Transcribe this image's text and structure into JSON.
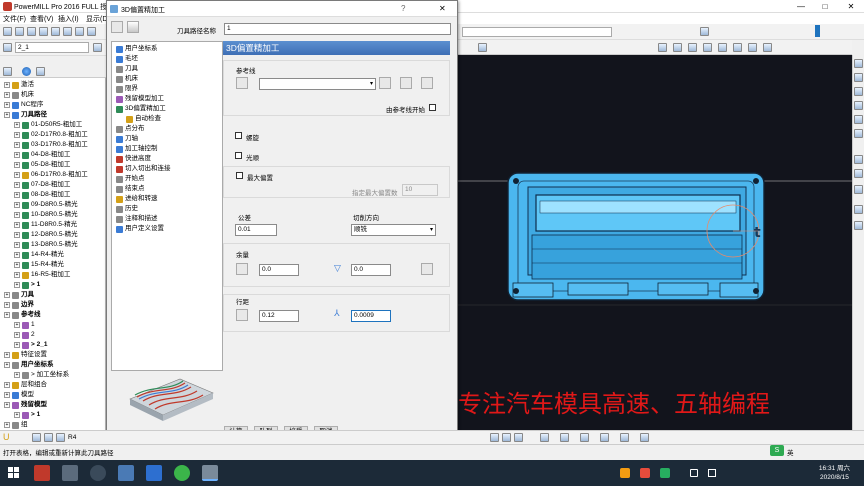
{
  "app": {
    "title": "PowerMILL Pro 2016 FULL 授",
    "window_buttons": [
      "—",
      "□",
      "✕"
    ]
  },
  "menu": {
    "items": [
      "文件(F)",
      "查看(V)",
      "插入(I)",
      "显示(D"
    ]
  },
  "toolbar": {
    "wcs_value": "2_1"
  },
  "explorer": {
    "items": [
      {
        "label": "激活",
        "indent": 0,
        "icon_color": "#d4a017"
      },
      {
        "label": "机床",
        "indent": 0,
        "icon_color": "#888888"
      },
      {
        "label": "NC程序",
        "indent": 0,
        "icon_color": "#3a7bd5"
      },
      {
        "label": "刀具路径",
        "indent": 0,
        "bold": true,
        "icon_color": "#3a7bd5"
      },
      {
        "label": "01-D50R5-粗加工",
        "indent": 1,
        "icon_color": "#2e8b57"
      },
      {
        "label": "02-D17R0.8-粗加工",
        "indent": 1,
        "icon_color": "#2e8b57"
      },
      {
        "label": "03-D17R0.8-粗加工",
        "indent": 1,
        "icon_color": "#2e8b57"
      },
      {
        "label": "04-D8-粗加工",
        "indent": 1,
        "icon_color": "#2e8b57"
      },
      {
        "label": "05-D8-粗加工",
        "indent": 1,
        "icon_color": "#2e8b57"
      },
      {
        "label": "06-D17R0.8-粗加工",
        "indent": 1,
        "icon_color": "#d4a017"
      },
      {
        "label": "07-D8-粗加工",
        "indent": 1,
        "icon_color": "#2e8b57"
      },
      {
        "label": "08-D8-粗加工",
        "indent": 1,
        "icon_color": "#2e8b57"
      },
      {
        "label": "09-D8R0.5-精光",
        "indent": 1,
        "icon_color": "#2e8b57"
      },
      {
        "label": "10-D8R0.5-精光",
        "indent": 1,
        "icon_color": "#2e8b57"
      },
      {
        "label": "11-D8R0.5-精光",
        "indent": 1,
        "icon_color": "#2e8b57"
      },
      {
        "label": "12-D8R0.5-精光",
        "indent": 1,
        "icon_color": "#2e8b57"
      },
      {
        "label": "13-D8R0.5-精光",
        "indent": 1,
        "icon_color": "#2e8b57"
      },
      {
        "label": "14-R4-精光",
        "indent": 1,
        "icon_color": "#2e8b57"
      },
      {
        "label": "15-R4-精光",
        "indent": 1,
        "icon_color": "#2e8b57"
      },
      {
        "label": "16-R5-粗加工",
        "indent": 1,
        "icon_color": "#d4a017"
      },
      {
        "label": "> 1",
        "indent": 1,
        "bold": true,
        "icon_color": "#2e8b57"
      },
      {
        "label": "刀具",
        "indent": 0,
        "bold": true,
        "icon_color": "#888888"
      },
      {
        "label": "边界",
        "indent": 0,
        "bold": true,
        "icon_color": "#888888"
      },
      {
        "label": "参考线",
        "indent": 0,
        "bold": true,
        "icon_color": "#888888"
      },
      {
        "label": "1",
        "indent": 1,
        "icon_color": "#9b59b6"
      },
      {
        "label": "2",
        "indent": 1,
        "icon_color": "#9b59b6"
      },
      {
        "label": "> 2_1",
        "indent": 1,
        "bold": true,
        "icon_color": "#9b59b6"
      },
      {
        "label": "特征设置",
        "indent": 0,
        "icon_color": "#d4a017"
      },
      {
        "label": "用户坐标系",
        "indent": 0,
        "bold": true,
        "icon_color": "#888888"
      },
      {
        "label": "> 加工坐标系",
        "indent": 1,
        "icon_color": "#888888"
      },
      {
        "label": "层和组合",
        "indent": 0,
        "icon_color": "#d4a017"
      },
      {
        "label": "模型",
        "indent": 0,
        "icon_color": "#3a7bd5"
      },
      {
        "label": "残留模型",
        "indent": 0,
        "bold": true,
        "icon_color": "#9b59b6"
      },
      {
        "label": "> 1",
        "indent": 1,
        "bold": true,
        "icon_color": "#9b59b6"
      },
      {
        "label": "组",
        "indent": 0,
        "icon_color": "#888888"
      }
    ]
  },
  "dialog": {
    "title": "3D偏置精加工",
    "help_button": "?",
    "close_button": "✕",
    "toolpath_name_label": "刀具路径名称",
    "toolpath_name_value": "1",
    "tree": [
      {
        "label": "用户坐标系",
        "indent": 0,
        "icon_color": "#3a7bd5"
      },
      {
        "label": "毛坯",
        "indent": 0,
        "icon_color": "#3a7bd5"
      },
      {
        "label": "刀具",
        "indent": 0,
        "icon_color": "#888888"
      },
      {
        "label": "机床",
        "indent": 0,
        "icon_color": "#888888"
      },
      {
        "label": "限界",
        "indent": 0,
        "icon_color": "#888888"
      },
      {
        "label": "残留模型加工",
        "indent": 0,
        "icon_color": "#9b59b6"
      },
      {
        "label": "3D偏置精加工",
        "indent": 0,
        "icon_color": "#2e8b57",
        "expand": true
      },
      {
        "label": "自动检查",
        "indent": 1,
        "icon_color": "#d4a017"
      },
      {
        "label": "点分布",
        "indent": 0,
        "icon_color": "#888888"
      },
      {
        "label": "刀轴",
        "indent": 0,
        "icon_color": "#3a7bd5"
      },
      {
        "label": "加工轴控制",
        "indent": 0,
        "icon_color": "#3a7bd5"
      },
      {
        "label": "快进高度",
        "indent": 0,
        "icon_color": "#c0392b"
      },
      {
        "label": "切入切出和连接",
        "indent": 0,
        "icon_color": "#c0392b",
        "expand": true
      },
      {
        "label": "开始点",
        "indent": 0,
        "icon_color": "#888888"
      },
      {
        "label": "结束点",
        "indent": 0,
        "icon_color": "#888888"
      },
      {
        "label": "进给和转速",
        "indent": 0,
        "icon_color": "#d4a017"
      },
      {
        "label": "历史",
        "indent": 0,
        "icon_color": "#888888"
      },
      {
        "label": "注释和描述",
        "indent": 0,
        "icon_color": "#888888"
      },
      {
        "label": "用户定义设置",
        "indent": 0,
        "icon_color": "#3a7bd5"
      }
    ],
    "panel": {
      "header": "3D偏置精加工",
      "reference_label": "参考线",
      "start_from_ref_label": "由参考线开始",
      "spiral_label": "螺旋",
      "smooth_label": "光顺",
      "max_offset_label": "最大偏置",
      "max_offset_count_label": "指定最大偏置数",
      "max_offset_count_value": "10",
      "tolerance_label": "公差",
      "tolerance_value": "0.01",
      "cut_direction_label": "切削方向",
      "cut_direction_value": "顺铣",
      "allowance_label": "余量",
      "allowance_value_1": "0.0",
      "allowance_value_2": "0.0",
      "stepover_label": "行距",
      "stepover_value": "0.12",
      "stepdown_value": "0.0009"
    },
    "buttons": {
      "calculate": "计算",
      "queue": "队列",
      "accept": "接受",
      "cancel": "取消"
    }
  },
  "bottom_toolbar": {
    "tool_value": "R4"
  },
  "status": {
    "text": "打开表格，编辑或重新计算此刀具路径"
  },
  "overlay": {
    "text": "专注汽车模具高速、五轴编程"
  },
  "taskbar": {
    "time": "16:31 周六",
    "date": "2020/8/15",
    "ime": "英"
  }
}
